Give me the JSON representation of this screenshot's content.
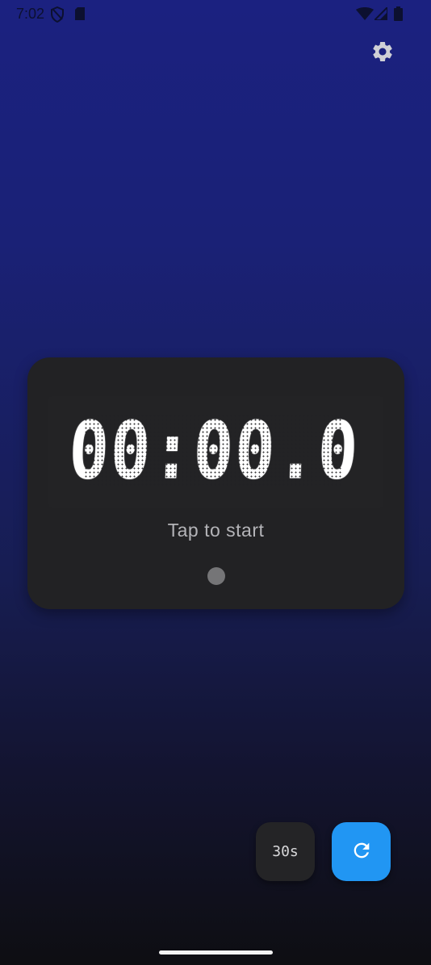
{
  "status_bar": {
    "time": "7:02",
    "icons": [
      "shield-icon",
      "sd-card-icon",
      "wifi-icon",
      "cellular-icon",
      "battery-icon"
    ]
  },
  "header": {
    "settings_icon": "gear-icon"
  },
  "timer": {
    "display": "00:00.0",
    "hint": "Tap to start"
  },
  "actions": {
    "preset_label": "30s",
    "reset_icon": "refresh-icon"
  },
  "colors": {
    "accent": "#2196f3",
    "card": "#222224",
    "background_top": "#1b2180",
    "background_bottom": "#0e0e12"
  }
}
